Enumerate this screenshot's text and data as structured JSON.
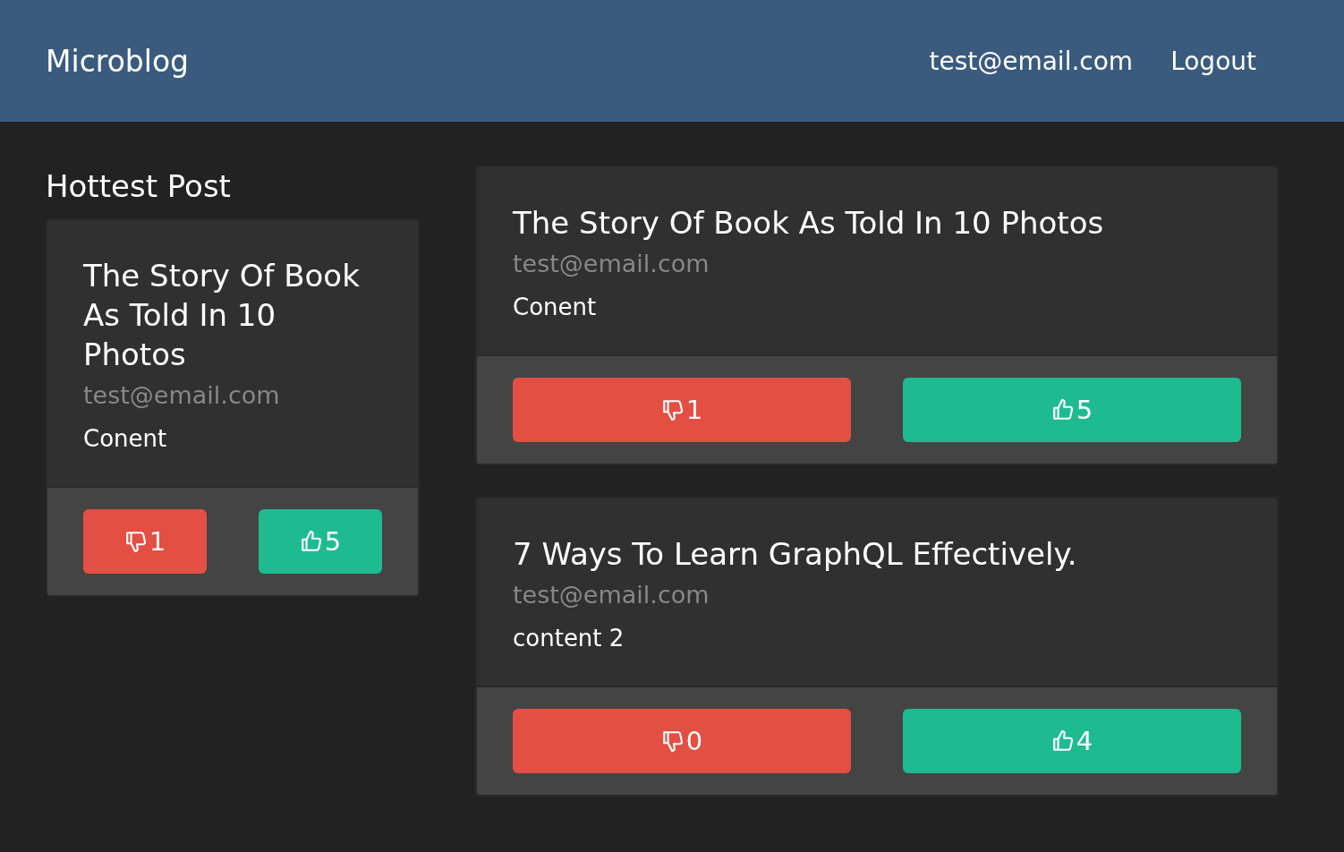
{
  "navbar": {
    "brand": "Microblog",
    "user": "test@email.com",
    "logout": "Logout"
  },
  "hottest": {
    "heading": "Hottest Post",
    "post": {
      "title": "The Story Of Book As Told In 10 Photos",
      "author": "test@email.com",
      "content": "Conent",
      "dislikes": "1",
      "likes": "5"
    }
  },
  "posts": [
    {
      "title": "The Story Of Book As Told In 10 Photos",
      "author": "test@email.com",
      "content": "Conent",
      "dislikes": "1",
      "likes": "5"
    },
    {
      "title": "7 Ways To Learn GraphQL Effectively.",
      "author": "test@email.com",
      "content": "content 2",
      "dislikes": "0",
      "likes": "4"
    }
  ]
}
